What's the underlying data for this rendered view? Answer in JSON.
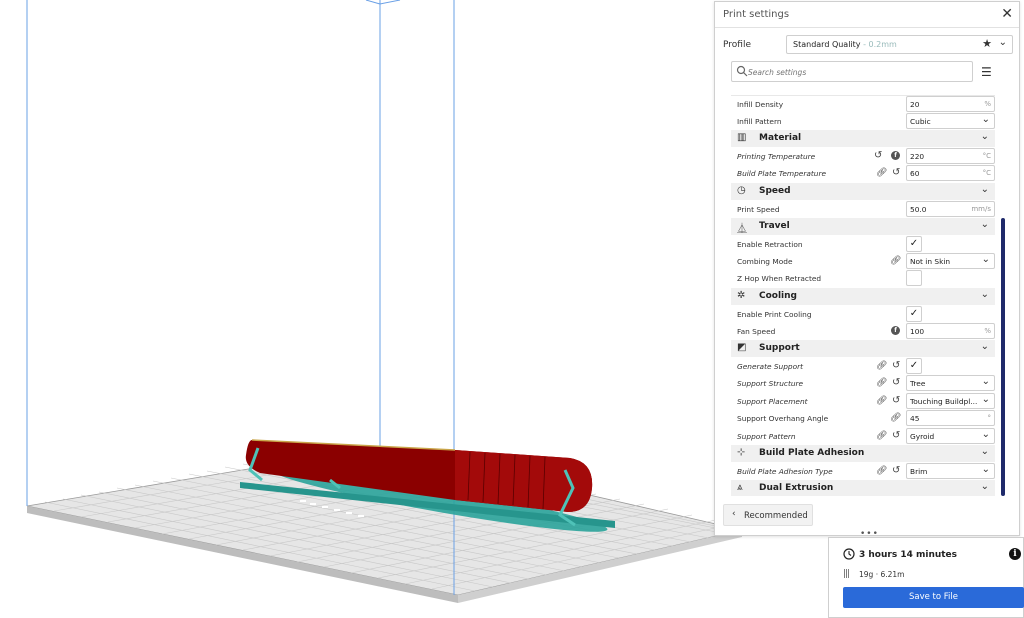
{
  "panel": {
    "title": "Print settings",
    "profile_label": "Profile",
    "profile_value": "Standard Quality",
    "profile_sub": " - 0.2mm",
    "search_placeholder": "Search settings",
    "recommended_label": "Recommended",
    "handle": "•••"
  },
  "rows": {
    "infill_density": {
      "label": "Infill Density",
      "value": "20",
      "unit": "%"
    },
    "infill_pattern": {
      "label": "Infill Pattern",
      "value": "Cubic"
    },
    "material": {
      "label": "Material"
    },
    "printing_temp": {
      "label": "Printing Temperature",
      "value": "220",
      "unit": "°C"
    },
    "build_plate_temp": {
      "label": "Build Plate Temperature",
      "value": "60",
      "unit": "°C"
    },
    "speed": {
      "label": "Speed"
    },
    "print_speed": {
      "label": "Print Speed",
      "value": "50.0",
      "unit": "mm/s"
    },
    "travel": {
      "label": "Travel"
    },
    "enable_retraction": {
      "label": "Enable Retraction",
      "checked": "✓"
    },
    "combing_mode": {
      "label": "Combing Mode",
      "value": "Not in Skin"
    },
    "z_hop": {
      "label": "Z Hop When Retracted",
      "checked": ""
    },
    "cooling": {
      "label": "Cooling"
    },
    "enable_cooling": {
      "label": "Enable Print Cooling",
      "checked": "✓"
    },
    "fan_speed": {
      "label": "Fan Speed",
      "value": "100",
      "unit": "%"
    },
    "support": {
      "label": "Support"
    },
    "generate_support": {
      "label": "Generate Support",
      "checked": "✓"
    },
    "support_structure": {
      "label": "Support Structure",
      "value": "Tree"
    },
    "support_placement": {
      "label": "Support Placement",
      "value": "Touching Buildpl..."
    },
    "support_overhang": {
      "label": "Support Overhang Angle",
      "value": "45",
      "unit": "°"
    },
    "support_pattern": {
      "label": "Support Pattern",
      "value": "Gyroid"
    },
    "adhesion": {
      "label": "Build Plate Adhesion"
    },
    "adhesion_type": {
      "label": "Build Plate Adhesion Type",
      "value": "Brim"
    },
    "dual": {
      "label": "Dual Extrusion"
    }
  },
  "action": {
    "time": "3 hours 14 minutes",
    "material": "19g · 6.21m",
    "save_label": "Save to File"
  },
  "colors": {
    "accent": "#2a6ad9",
    "model": "#8b0000",
    "support": "#2aa39a",
    "scrollbar": "#1f2a6b"
  }
}
